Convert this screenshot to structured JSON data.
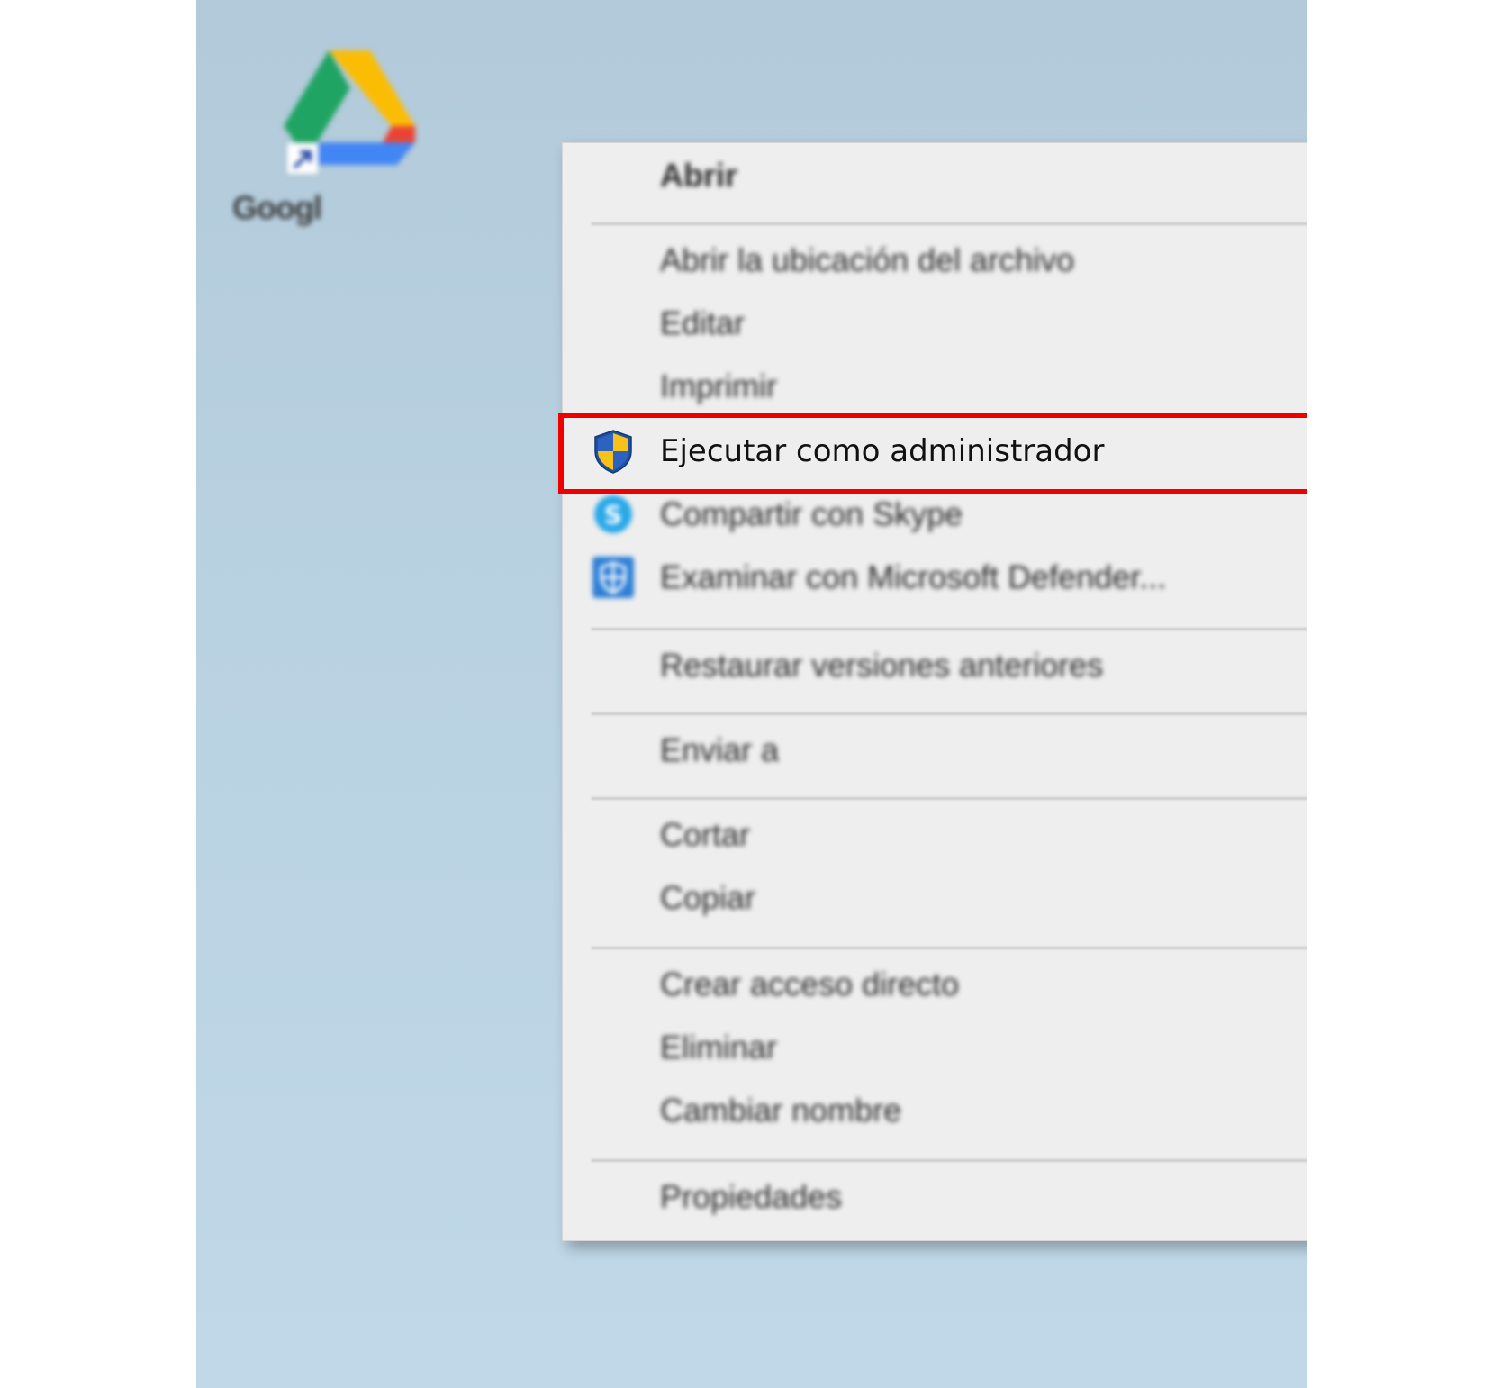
{
  "desktop": {
    "shortcut_label": "Googl",
    "icon_name": "google-drive-icon"
  },
  "context_menu": {
    "items": [
      {
        "label": "Abrir",
        "icon": null
      },
      {
        "label": "Abrir la ubicación del archivo",
        "icon": null
      },
      {
        "label": "Editar",
        "icon": null
      },
      {
        "label": "Imprimir",
        "icon": null
      },
      {
        "label": "Ejecutar como administrador",
        "icon": "uac-shield-icon",
        "highlighted": true
      },
      {
        "label": "Compartir con Skype",
        "icon": "skype-icon"
      },
      {
        "label": "Examinar con Microsoft Defender...",
        "icon": "defender-icon"
      },
      {
        "label": "Restaurar versiones anteriores",
        "icon": null
      },
      {
        "label": "Enviar a",
        "icon": null,
        "submenu": true
      },
      {
        "label": "Cortar",
        "icon": null
      },
      {
        "label": "Copiar",
        "icon": null
      },
      {
        "label": "Crear acceso directo",
        "icon": null
      },
      {
        "label": "Eliminar",
        "icon": null
      },
      {
        "label": "Cambiar nombre",
        "icon": null
      },
      {
        "label": "Propiedades",
        "icon": null
      }
    ]
  },
  "colors": {
    "highlight_border": "#ee0000",
    "menu_background": "#eeeeee",
    "desktop_background": "#b9d2e2"
  }
}
